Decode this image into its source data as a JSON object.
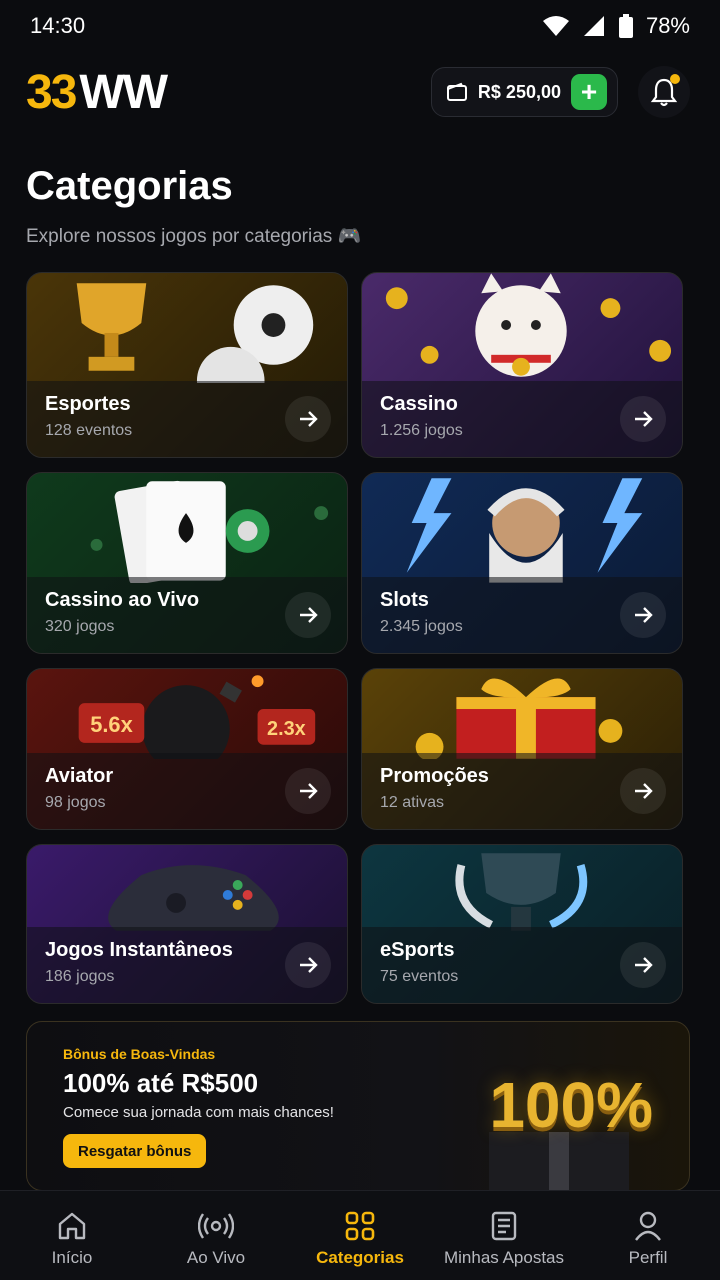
{
  "status": {
    "time": "14:30",
    "battery": "78%"
  },
  "header": {
    "logo_number": "33",
    "logo_letters": "WW",
    "balance": "R$ 250,00",
    "icons": {
      "wallet": "wallet-icon",
      "add": "plus-icon",
      "notifications": "bell-icon"
    }
  },
  "page": {
    "title": "Categorias",
    "subtitle": "Explore nossos jogos por categorias 🎮"
  },
  "categories": [
    {
      "name": "Esportes",
      "count": "128 eventos"
    },
    {
      "name": "Cassino",
      "count": "1.256 jogos"
    },
    {
      "name": "Cassino ao Vivo",
      "count": "320 jogos"
    },
    {
      "name": "Slots",
      "count": "2.345 jogos"
    },
    {
      "name": "Aviator",
      "count": "98 jogos",
      "multipliers": [
        "5.6x",
        "2.3x"
      ]
    },
    {
      "name": "Promoções",
      "count": "12 ativas"
    },
    {
      "name": "Jogos Instantâneos",
      "count": "186 jogos"
    },
    {
      "name": "eSports",
      "count": "75 eventos"
    }
  ],
  "promo": {
    "tag": "Bônus de Boas-Vindas",
    "headline": "100% até R$500",
    "description": "Comece sua jornada com mais chances!",
    "button": "Resgatar bônus",
    "badge": "100%"
  },
  "tabs": [
    {
      "label": "Início",
      "icon": "home-icon"
    },
    {
      "label": "Ao Vivo",
      "icon": "live-icon"
    },
    {
      "label": "Categorias",
      "icon": "grid-icon",
      "active": true
    },
    {
      "label": "Minhas Apostas",
      "icon": "ticket-icon"
    },
    {
      "label": "Perfil",
      "icon": "user-icon"
    }
  ],
  "colors": {
    "accent": "#f6b70d",
    "add": "#2bb94b",
    "background": "#0b0c0f"
  }
}
